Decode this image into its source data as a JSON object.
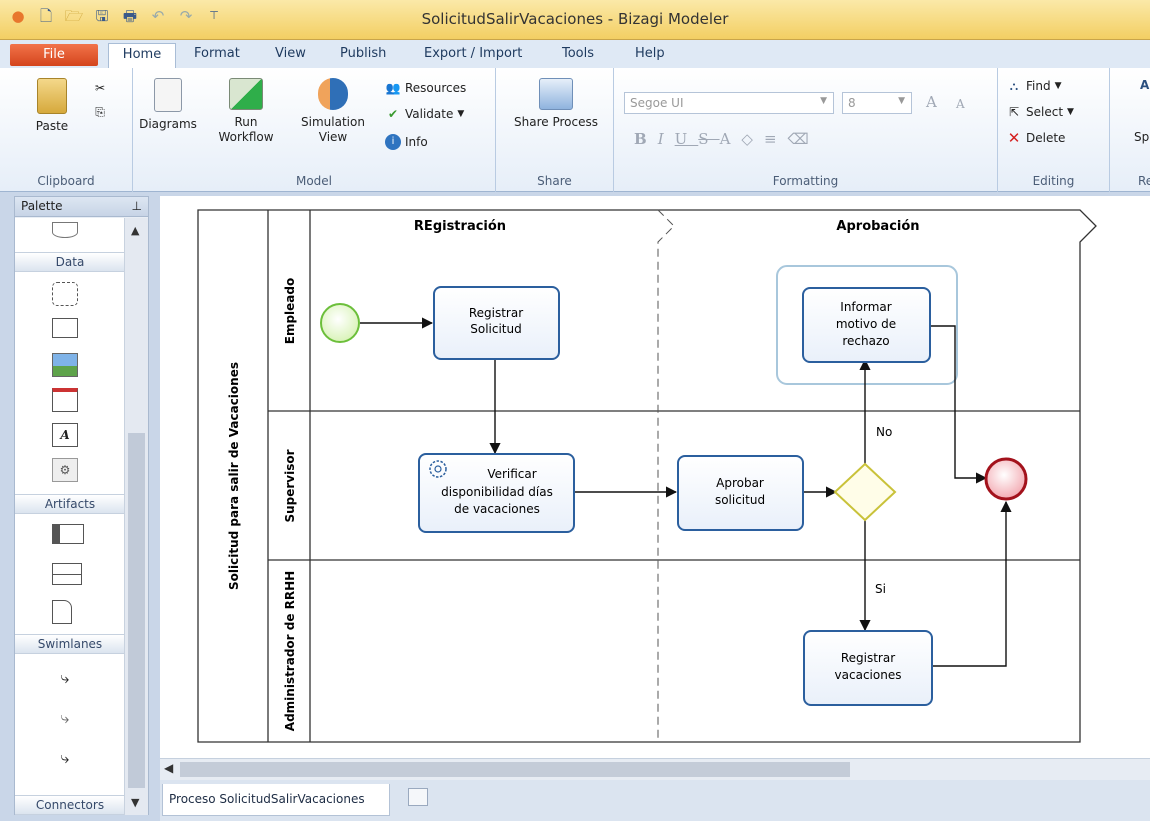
{
  "window": {
    "title": "SolicitudSalirVacaciones - Bizagi Modeler"
  },
  "tabs": {
    "file": "File",
    "home": "Home",
    "format": "Format",
    "view": "View",
    "publish": "Publish",
    "export_import": "Export / Import",
    "tools": "Tools",
    "help": "Help"
  },
  "ribbon": {
    "clipboard": {
      "label": "Clipboard",
      "paste": "Paste"
    },
    "model": {
      "label": "Model",
      "diagrams": "Diagrams",
      "run_workflow_1": "Run",
      "run_workflow_2": "Workflow",
      "simulation_1": "Simulation",
      "simulation_2": "View",
      "resources": "Resources",
      "validate": "Validate",
      "info": "Info"
    },
    "share": {
      "label": "Share",
      "share_process": "Share Process"
    },
    "formatting": {
      "label": "Formatting",
      "font": "Segoe UI",
      "size": "8"
    },
    "editing": {
      "label": "Editing",
      "find": "Find",
      "select": "Select",
      "delete": "Delete"
    },
    "cut_right_1": "A",
    "cut_right_2": "Sp",
    "cut_right_3": "Re"
  },
  "palette": {
    "title": "Palette",
    "sections": {
      "data": "Data",
      "artifacts": "Artifacts",
      "swimlanes": "Swimlanes",
      "connectors": "Connectors"
    }
  },
  "diagram": {
    "pool": "Solicitud  para salir de Vacaciones",
    "phases": [
      "REgistración",
      "Aprobación"
    ],
    "lanes": [
      "Empleado",
      "Supervisor",
      "Administrador de RRHH"
    ],
    "tasks": {
      "registrar_solicitud": [
        "Registrar",
        "Solicitud"
      ],
      "verificar": [
        "Verificar",
        "disponibilidad días",
        "de vacaciones"
      ],
      "aprobar": [
        "Aprobar",
        "solicitud"
      ],
      "informar": [
        "Informar",
        "motivo de",
        "rechazo"
      ],
      "registrar_vacaciones": [
        "Registrar",
        "vacaciones"
      ]
    },
    "labels": {
      "no": "No",
      "si": "Si"
    }
  },
  "document_tab": "Proceso SolicitudSalirVacaciones"
}
